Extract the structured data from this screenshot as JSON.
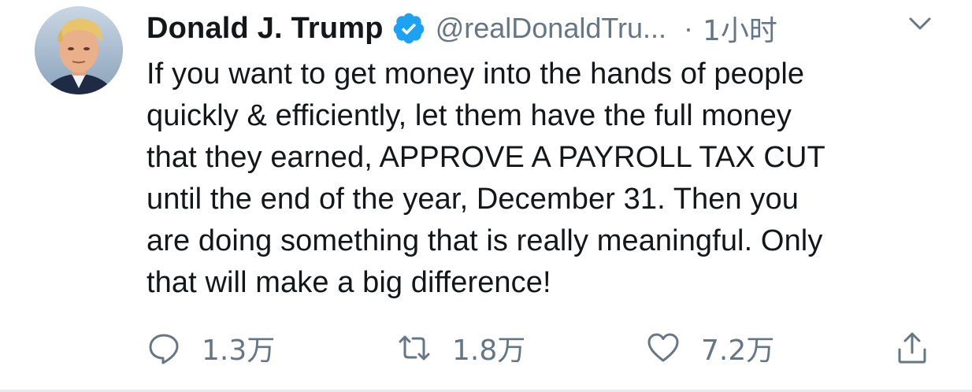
{
  "tweet": {
    "author": {
      "display_name": "Donald J. Trump",
      "handle": "@realDonaldTru...",
      "verified": true,
      "avatar_icon": "profile-photo"
    },
    "separator": "·",
    "time": "1小时",
    "menu_icon": "chevron-down-icon",
    "text": "If you want to get money into the hands of people\nquickly & efficiently, let them have the full money\nthat they earned, APPROVE A PAYROLL TAX CUT\nuntil the end of the year, December 31. Then you\nare doing something that is really meaningful. Only\nthat will make a big difference!",
    "actions": {
      "reply": {
        "icon": "comment-icon",
        "count": "1.3万"
      },
      "retweet": {
        "icon": "retweet-icon",
        "count": "1.8万"
      },
      "like": {
        "icon": "heart-icon",
        "count": "7.2万"
      },
      "share": {
        "icon": "share-icon"
      }
    }
  },
  "colors": {
    "text_primary": "#14171a",
    "text_secondary": "#657786",
    "verified_blue": "#1da1f2",
    "border": "#e6ecf0"
  }
}
